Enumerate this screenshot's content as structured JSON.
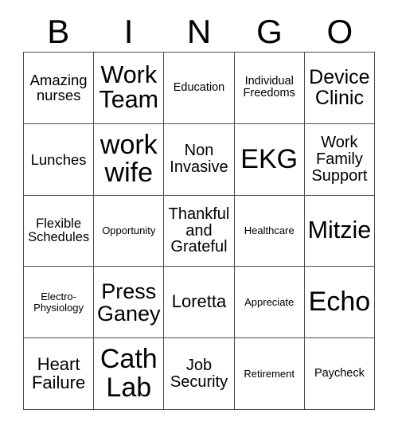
{
  "card": {
    "title": "BINGO",
    "header_letters": [
      "B",
      "I",
      "N",
      "G",
      "O"
    ],
    "columns": 5,
    "rows": 5,
    "border_color": "#4d4d4d",
    "background_color": "#ffffff",
    "text_color": "#000000",
    "cells": [
      {
        "text": "Amazing\nnurses",
        "column": "B",
        "row": 1,
        "size": "fs-18",
        "marked": false
      },
      {
        "text": "Work\nTeam",
        "column": "I",
        "row": 1,
        "size": "fs-30",
        "marked": false
      },
      {
        "text": "Education",
        "column": "N",
        "row": 1,
        "size": "fs-14",
        "marked": false
      },
      {
        "text": "Individual\nFreedoms",
        "column": "G",
        "row": 1,
        "size": "fs-14",
        "marked": false
      },
      {
        "text": "Device\nClinic",
        "column": "O",
        "row": 1,
        "size": "fs-25",
        "marked": false
      },
      {
        "text": "Lunches",
        "column": "B",
        "row": 2,
        "size": "fs-18",
        "marked": false
      },
      {
        "text": "work\nwife",
        "column": "I",
        "row": 2,
        "size": "fs-34",
        "marked": false
      },
      {
        "text": "Non\nInvasive",
        "column": "N",
        "row": 2,
        "size": "fs-20",
        "marked": false
      },
      {
        "text": "EKG",
        "column": "G",
        "row": 2,
        "size": "fs-34",
        "marked": false
      },
      {
        "text": "Work\nFamily\nSupport",
        "column": "O",
        "row": 2,
        "size": "fs-20",
        "marked": false
      },
      {
        "text": "Flexible\nSchedules",
        "column": "B",
        "row": 3,
        "size": "fs-16",
        "marked": false
      },
      {
        "text": "Opportunity",
        "column": "I",
        "row": 3,
        "size": "fs-13",
        "marked": false
      },
      {
        "text": "Thankful\nand\nGrateful",
        "column": "N",
        "row": 3,
        "size": "fs-20",
        "marked": false
      },
      {
        "text": "Healthcare",
        "column": "G",
        "row": 3,
        "size": "fs-13",
        "marked": false
      },
      {
        "text": "Mitzie",
        "column": "O",
        "row": 3,
        "size": "fs-30",
        "marked": false
      },
      {
        "text": "Electro-\nPhysiology",
        "column": "B",
        "row": 4,
        "size": "fs-13",
        "marked": false
      },
      {
        "text": "Press\nGaney",
        "column": "I",
        "row": 4,
        "size": "fs-27",
        "marked": false
      },
      {
        "text": "Loretta",
        "column": "N",
        "row": 4,
        "size": "fs-22",
        "marked": false
      },
      {
        "text": "Appreciate",
        "column": "G",
        "row": 4,
        "size": "fs-13",
        "marked": false
      },
      {
        "text": "Echo",
        "column": "O",
        "row": 4,
        "size": "fs-34",
        "marked": false
      },
      {
        "text": "Heart\nFailure",
        "column": "B",
        "row": 5,
        "size": "fs-22",
        "marked": false
      },
      {
        "text": "Cath\nLab",
        "column": "I",
        "row": 5,
        "size": "fs-34",
        "marked": false
      },
      {
        "text": "Job\nSecurity",
        "column": "N",
        "row": 5,
        "size": "fs-20",
        "marked": false
      },
      {
        "text": "Retirement",
        "column": "G",
        "row": 5,
        "size": "fs-13",
        "marked": false
      },
      {
        "text": "Paycheck",
        "column": "O",
        "row": 5,
        "size": "fs-14",
        "marked": false
      }
    ]
  }
}
